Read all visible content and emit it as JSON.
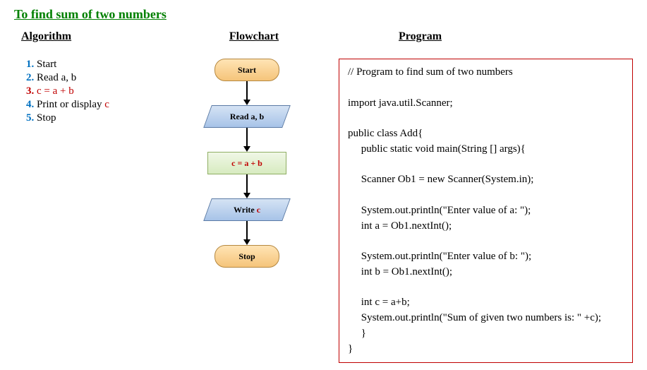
{
  "title": "To find sum of two numbers",
  "headers": {
    "algo": "Algorithm",
    "flow": "Flowchart",
    "prog": "Program"
  },
  "algorithm": {
    "s1": "Start",
    "s2": "Read a, b",
    "s3": "c = a + b",
    "s4_pre": "Print or display ",
    "s4_c": "c",
    "s5": "Stop"
  },
  "flowchart": {
    "start": "Start",
    "read": "Read a, b",
    "process": "c = a + b",
    "write_pre": "Write ",
    "write_c": "c",
    "stop": "Stop"
  },
  "program": "// Program to find sum of two numbers\n\nimport java.util.Scanner;\n\npublic class Add{\n     public static void main(String [] args){\n\n     Scanner Ob1 = new Scanner(System.in);\n\n     System.out.println(\"Enter value of a: \");\n     int a = Ob1.nextInt();\n\n     System.out.println(\"Enter value of b: \");\n     int b = Ob1.nextInt();\n\n     int c = a+b;\n     System.out.println(\"Sum of given two numbers is: \" +c);\n     }\n}"
}
